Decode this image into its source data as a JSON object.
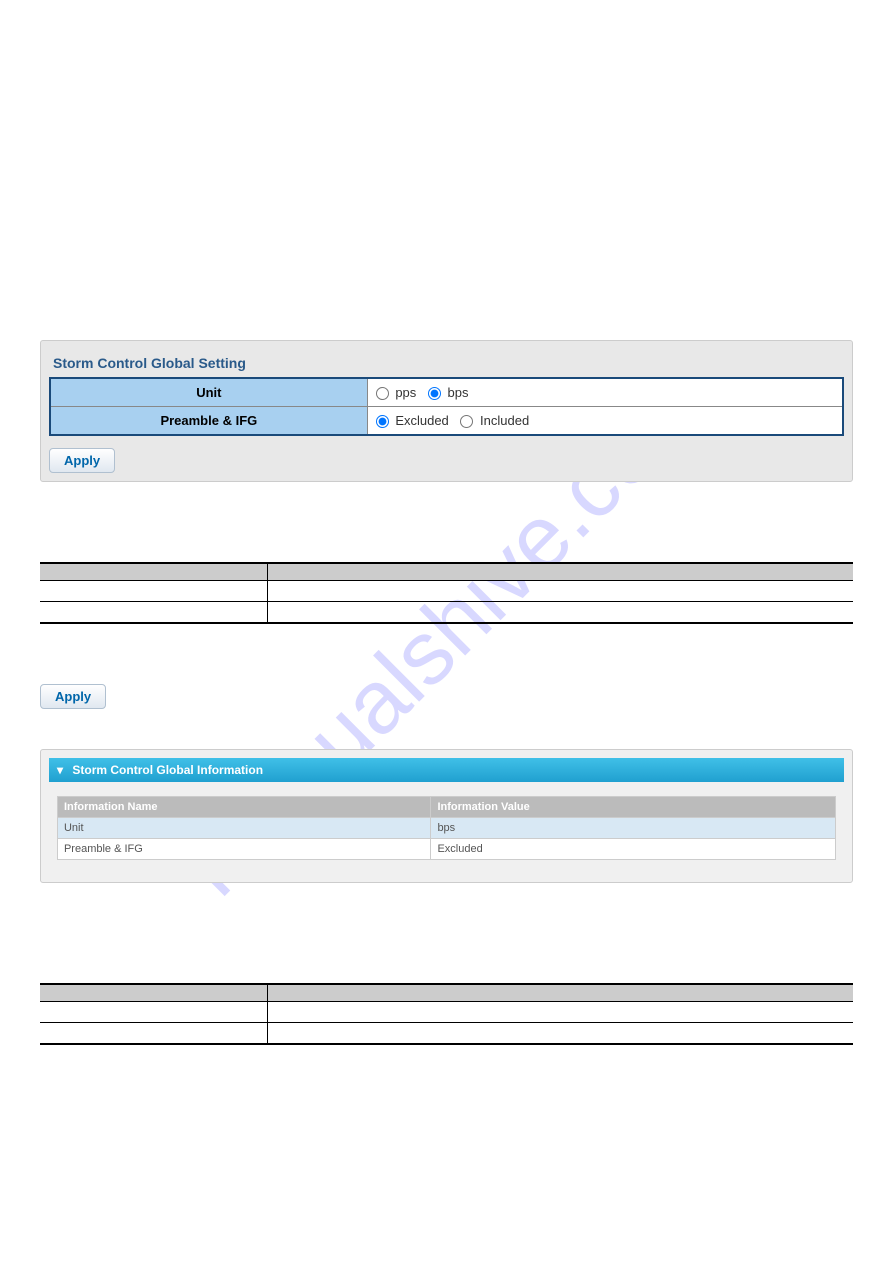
{
  "watermark": "manualshive.com",
  "settings": {
    "title": "Storm Control Global Setting",
    "rows": [
      {
        "label": "Unit",
        "options": [
          "pps",
          "bps"
        ],
        "selected": "bps"
      },
      {
        "label": "Preamble & IFG",
        "options": [
          "Excluded",
          "Included"
        ],
        "selected": "Excluded"
      }
    ],
    "apply_label": "Apply"
  },
  "desc_table_1": {
    "header": [
      "",
      ""
    ],
    "rows": [
      {
        "col1": "",
        "col2": ""
      },
      {
        "col1": "",
        "col2": ""
      }
    ]
  },
  "apply_standalone": "Apply",
  "info_panel": {
    "title": "Storm Control Global Information",
    "header": [
      "Information Name",
      "Information Value"
    ],
    "rows": [
      {
        "name": "Unit",
        "value": "bps"
      },
      {
        "name": "Preamble & IFG",
        "value": "Excluded"
      }
    ]
  },
  "desc_table_2": {
    "header": [
      "",
      ""
    ],
    "rows": [
      {
        "col1": "",
        "col2": ""
      },
      {
        "col1": "",
        "col2": ""
      }
    ]
  }
}
